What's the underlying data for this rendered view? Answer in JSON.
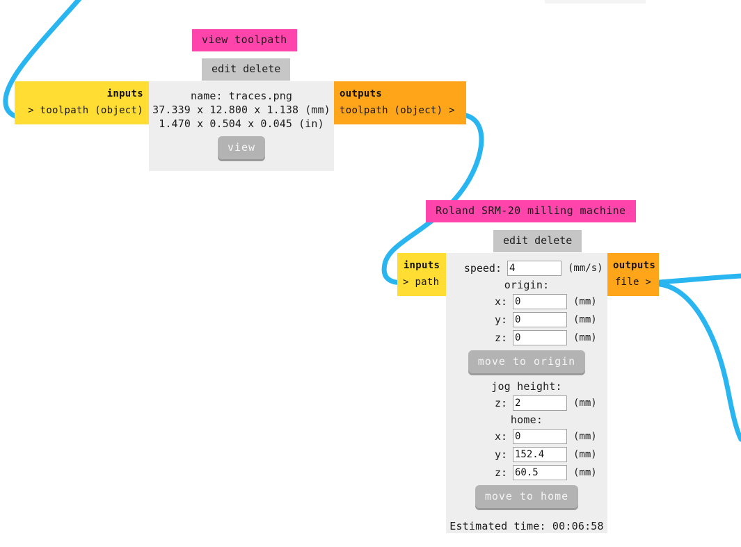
{
  "canvas": {
    "wire_color": "#29b6f0",
    "background": "#ffffff"
  },
  "palette": {
    "title_pink": "#ff45ab",
    "actions_gray": "#c6c6c6",
    "body_gray": "#eeeeee",
    "inputs_yellow": "#ffdd33",
    "outputs_orange": "#ffa51a",
    "button_gray": "#b3b3b3"
  },
  "nodes": [
    {
      "id": "toolpath-viewer",
      "title": "view toolpath",
      "actions": "edit delete",
      "inputs": {
        "header": "inputs",
        "items": [
          "> toolpath (object)"
        ]
      },
      "outputs": {
        "header": "outputs",
        "items": [
          "toolpath (object) >"
        ]
      },
      "info": [
        "name: traces.png",
        "37.339 x 12.800 x 1.138 (mm)",
        "1.470 x 0.504 x 0.045 (in)"
      ],
      "view_button": "view"
    },
    {
      "id": "roland-srm20",
      "title": "Roland SRM-20 milling machine",
      "actions": "edit delete",
      "inputs": {
        "header": "inputs",
        "items": [
          "> path"
        ]
      },
      "outputs": {
        "header": "outputs",
        "items": [
          "file >"
        ]
      },
      "speed": {
        "label": "speed:",
        "value": "4",
        "unit": "(mm/s)"
      },
      "origin": {
        "label": "origin:",
        "x": {
          "label": "x:",
          "value": "0",
          "unit": "(mm)"
        },
        "y": {
          "label": "y:",
          "value": "0",
          "unit": "(mm)"
        },
        "z": {
          "label": "z:",
          "value": "0",
          "unit": "(mm)"
        },
        "button": "move to origin"
      },
      "jog_height": {
        "label": "jog height:",
        "z": {
          "label": "z:",
          "value": "2",
          "unit": "(mm)"
        }
      },
      "home": {
        "label": "home:",
        "x": {
          "label": "x:",
          "value": "0",
          "unit": "(mm)"
        },
        "y": {
          "label": "y:",
          "value": "152.4",
          "unit": "(mm)"
        },
        "z": {
          "label": "z:",
          "value": "60.5",
          "unit": "(mm)"
        },
        "button": "move to home"
      },
      "estimated_time": "Estimated time: 00:06:58"
    }
  ]
}
